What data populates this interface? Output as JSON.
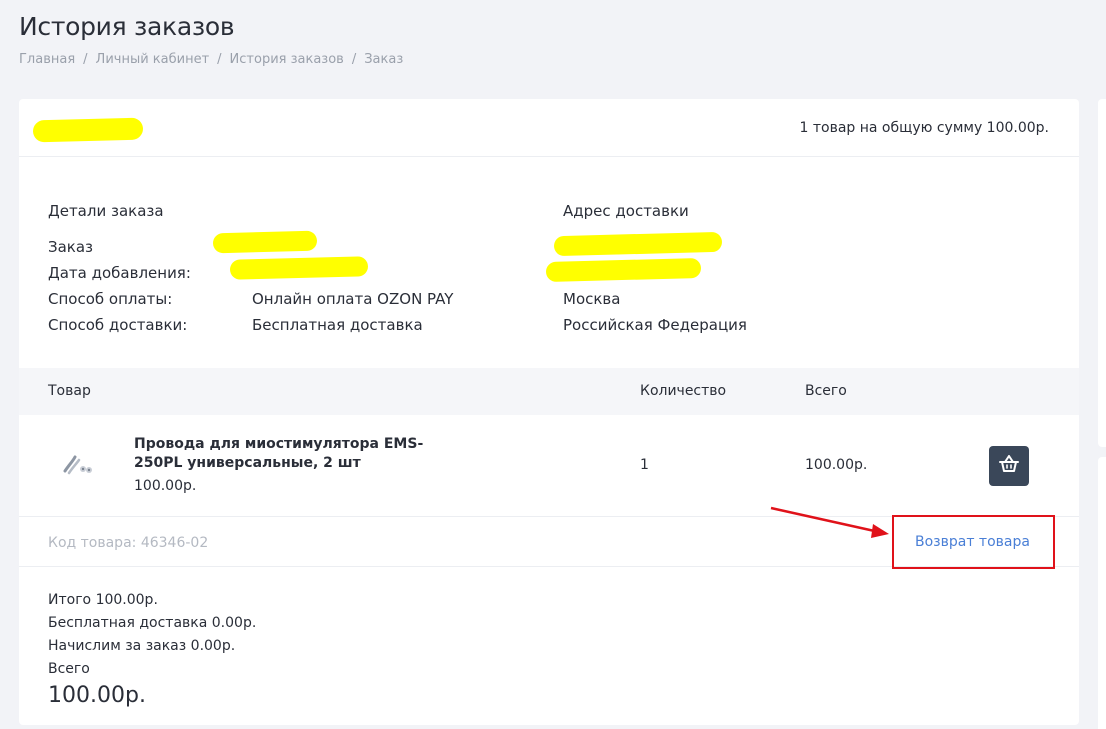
{
  "page": {
    "title": "История заказов"
  },
  "breadcrumb": [
    "Главная",
    "Личный кабинет",
    "История заказов",
    "Заказ"
  ],
  "order": {
    "summary": "1 товар на общую сумму 100.00р.",
    "details_heading": "Детали заказа",
    "address_heading": "Адрес доставки",
    "labels": {
      "order": "Заказ",
      "date_added": "Дата добавления:",
      "payment_method": "Способ оплаты:",
      "delivery_method": "Способ доставки:"
    },
    "payment_method": "Онлайн оплата OZON PAY",
    "delivery_method": "Бесплатная доставка",
    "address": {
      "city": "Москва",
      "country": "Российская Федерация"
    }
  },
  "table": {
    "headers": {
      "product": "Товар",
      "quantity": "Количество",
      "total": "Всего"
    },
    "items": [
      {
        "name": "Провода для миостимулятора EMS-250PL универсальные, 2 шт",
        "price": "100.00р.",
        "quantity": "1",
        "total": "100.00р.",
        "code": "Код товара: 46346-02",
        "return_label": "Возврат товара",
        "icon": "basket-icon"
      }
    ]
  },
  "totals": {
    "subtotal": "Итого 100.00р.",
    "delivery": "Бесплатная доставка 0.00р.",
    "bonus": "Начислим за заказ 0.00р.",
    "total_label": "Всего",
    "total_value": "100.00р."
  },
  "colors": {
    "accent_link": "#4a7fd6",
    "annotation_red": "#e0121a",
    "redaction_yellow": "#ffff00",
    "button_dark": "#3a4759"
  }
}
